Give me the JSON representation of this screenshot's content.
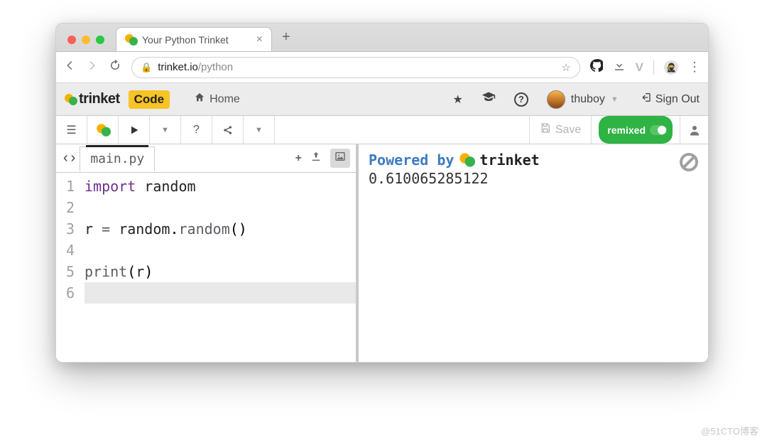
{
  "browser": {
    "tab_title": "Your Python Trinket",
    "url_host": "trinket.io",
    "url_path": "/python"
  },
  "site_header": {
    "brand": "trinket",
    "badge": "Code",
    "home": "Home",
    "username": "thuboy",
    "signout": "Sign Out"
  },
  "toolbar": {
    "save": "Save",
    "remixed": "remixed"
  },
  "editor": {
    "filename": "main.py",
    "lines": [
      [
        "kw",
        "import",
        " ",
        "id",
        "random"
      ],
      [],
      [
        "id",
        "r ",
        "op",
        "= ",
        "id",
        "random",
        ".",
        "fn",
        "random",
        "()"
      ],
      [],
      [
        "fn",
        "print",
        "(",
        "id",
        "r",
        ")"
      ],
      []
    ],
    "line_count": 6,
    "active_line": 6
  },
  "output": {
    "powered": "Powered by",
    "brand": "trinket",
    "value": "0.610065285122"
  },
  "watermark": "@51CTO博客"
}
